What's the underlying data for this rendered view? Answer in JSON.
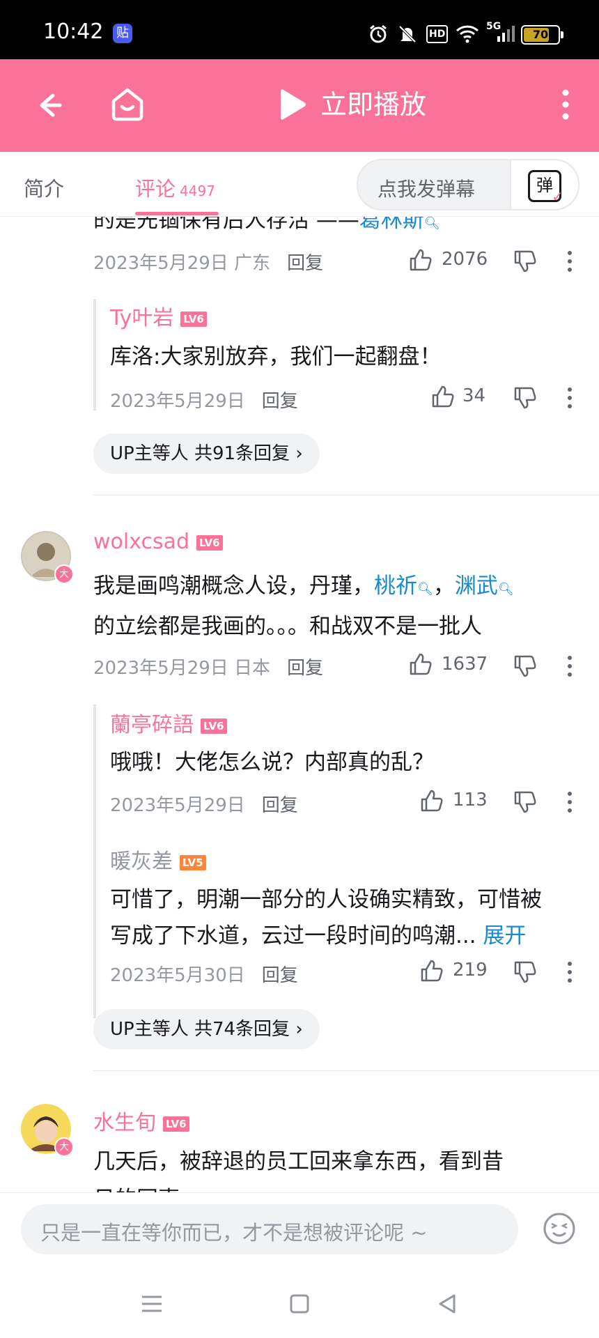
{
  "status": {
    "time": "10:42",
    "app_badge": "贴",
    "battery": "70",
    "network": "5G",
    "hd": "HD"
  },
  "header": {
    "title": "立即播放"
  },
  "tabs": [
    {
      "label": "简介"
    },
    {
      "label": "评论",
      "count": "4497"
    }
  ],
  "danmu": {
    "placeholder": "点我发弹幕",
    "button": "弹"
  },
  "comments": [
    {
      "text_line1": "的是先锢保有后人存活 ——",
      "text_link": "葛林斯",
      "date": "2023年5月29日 广东",
      "reply": "回复",
      "likes": "2076",
      "subreplies": [
        {
          "user": "Ty叶岩",
          "level": "LV6",
          "text": "库洛:大家别放弃，我们一起翻盘！",
          "date": "2023年5月29日",
          "reply": "回复",
          "likes": "34"
        }
      ],
      "more": "UP主等人 共91条回复 ›"
    },
    {
      "user": "wolxcsad",
      "level": "LV6",
      "badge": "大",
      "text_a": "我是画鸣潮概念人设，丹瑾，",
      "link1": "桃祈",
      "sep": "，",
      "link2": "渊武",
      "text_line2": "的立绘都是我画的。。。和战双不是一批人",
      "date": "2023年5月29日 日本",
      "reply": "回复",
      "likes": "1637",
      "subreplies": [
        {
          "user": "蘭亭碎語",
          "level": "LV6",
          "text": "哦哦！大佬怎么说？内部真的乱？",
          "date": "2023年5月29日",
          "reply": "回复",
          "likes": "113"
        },
        {
          "user": "暖灰差",
          "level": "LV5",
          "text_line1": "可惜了，明潮一部分的人设确实精致，可惜被",
          "text_line2": "写成了下水道，云过一段时间的鸣潮...",
          "expand": "展开",
          "date": "2023年5月30日",
          "reply": "回复",
          "likes": "219"
        }
      ],
      "more": "UP主等人 共74条回复 ›"
    },
    {
      "user": "水生旬",
      "level": "LV6",
      "badge": "大",
      "text_line1": "几天后，被辞退的员工回来拿东西，看到昔",
      "text_line2": "日的同事"
    }
  ],
  "input": {
    "placeholder": "只是一直在等你而已，才不是想被评论呢 ~"
  },
  "colors": {
    "brand_pink": "#fb7299",
    "link_blue": "#178bcf",
    "level_orange": "#ff8637"
  }
}
